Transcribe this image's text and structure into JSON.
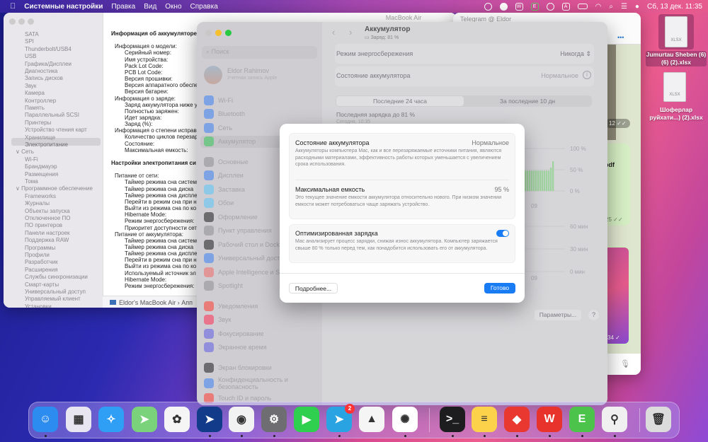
{
  "menubar": {
    "app": "Системные настройки",
    "items": [
      "Правка",
      "Вид",
      "Окно",
      "Справка"
    ],
    "clock": "Сб, 13 дек. 11:35"
  },
  "sysinfo": {
    "title": "MacBook Air",
    "sidebar": [
      "SATA",
      "SPI",
      "Thunderbolt/USB4",
      "USB",
      "Графика/Дисплеи",
      "Диагностика",
      "Запись дисков",
      "Звук",
      "Камера",
      "Контроллер",
      "Память",
      "Параллельный SCSI",
      "Принтеры",
      "Устройство чтения карт",
      "Хранилище",
      "Электропитание",
      "∨ Сеть",
      "Wi-Fi",
      "Брандмауэр",
      "Размещения",
      "Тома",
      "∨ Программное обеспечение",
      "Frameworks",
      "Журналы",
      "Объекты запуска",
      "Отключенное ПО",
      "ПО принтеров",
      "Панели настроек",
      "Поддержка RAW",
      "Программы",
      "Профили",
      "Разработчик",
      "Расширения",
      "Службы синхронизации",
      "Смарт-карты",
      "Универсальный доступ",
      "Управляемый клиент",
      "Установки"
    ],
    "selected": "Электропитание",
    "lines": [
      {
        "t": "Информация об аккумуляторе",
        "l": 0,
        "b": true
      },
      {
        "t": "",
        "l": 0
      },
      {
        "t": "Информация о модели:",
        "l": 1
      },
      {
        "t": "Серийный номер:",
        "l": 2
      },
      {
        "t": "Имя устройства:",
        "l": 2
      },
      {
        "t": "Pack Lot Code:",
        "l": 2
      },
      {
        "t": "PCB Lot Code:",
        "l": 2
      },
      {
        "t": "Версия прошивки:",
        "l": 2
      },
      {
        "t": "Версия аппаратного обеспе",
        "l": 2
      },
      {
        "t": "Версия батареи:",
        "l": 2
      },
      {
        "t": "Информация о заряде:",
        "l": 1
      },
      {
        "t": "Заряд аккумулятора ниже у",
        "l": 2
      },
      {
        "t": "Полностью заряжен:",
        "l": 2
      },
      {
        "t": "Идет зарядка:",
        "l": 2
      },
      {
        "t": "Заряд (%):",
        "l": 2
      },
      {
        "t": "Информация о степени исправ",
        "l": 1
      },
      {
        "t": "Количество циклов перезар",
        "l": 2
      },
      {
        "t": "Состояние:",
        "l": 2
      },
      {
        "t": "Максимальная емкость:",
        "l": 2
      },
      {
        "t": "",
        "l": 0
      },
      {
        "t": "Настройки электропитания си",
        "l": 0,
        "b": true
      },
      {
        "t": "",
        "l": 0
      },
      {
        "t": "Питание от сети:",
        "l": 1
      },
      {
        "t": "Таймер режима сна систем",
        "l": 2
      },
      {
        "t": "Таймер режима сна диска",
        "l": 2
      },
      {
        "t": "Таймер режима сна диспле",
        "l": 2
      },
      {
        "t": "Перейти в режим сна при н",
        "l": 2
      },
      {
        "t": "Выйти из режима сна по ко",
        "l": 2
      },
      {
        "t": "Hibernate Mode:",
        "l": 2
      },
      {
        "t": "Режим энергосбережения:",
        "l": 2
      },
      {
        "t": "Приоритет доступности сет",
        "l": 2
      },
      {
        "t": "Питание от аккумулятора:",
        "l": 1
      },
      {
        "t": "Таймер режима сна систем",
        "l": 2
      },
      {
        "t": "Таймер режима сна диска",
        "l": 2
      },
      {
        "t": "Таймер режима сна диспле",
        "l": 2
      },
      {
        "t": "Перейти в режим сна при н",
        "l": 2
      },
      {
        "t": "Выйти из режима сна по ко",
        "l": 2
      },
      {
        "t": "Используемый источник эл",
        "l": 2
      },
      {
        "t": "Hibernate Mode:",
        "l": 2
      },
      {
        "t": "Режим энергосбережения:",
        "l": 2
      }
    ],
    "path": "Eldor's MacBook Air › Апп"
  },
  "telegram": {
    "title": "Telegram @ Eldor",
    "more": "•••",
    "msgs": [
      "12 ✓✓",
      ".pdf",
      "25 ✓✓",
      "34 ✓"
    ]
  },
  "settings": {
    "search_placeholder": "Поиск",
    "user": {
      "name": "Eldor Rahimov",
      "sub": "Учетная запись Apple"
    },
    "groups": [
      [
        {
          "label": "Wi-Fi",
          "color": "#3b82f6"
        },
        {
          "label": "Bluetooth",
          "color": "#3b82f6"
        },
        {
          "label": "Сеть",
          "color": "#3b82f6"
        },
        {
          "label": "Аккумулятор",
          "color": "#34c759"
        }
      ],
      [
        {
          "label": "Основные",
          "color": "#8e8e93"
        },
        {
          "label": "Дисплеи",
          "color": "#3b82f6"
        },
        {
          "label": "Заставка",
          "color": "#5ac8fa"
        },
        {
          "label": "Обои",
          "color": "#5ac8fa"
        },
        {
          "label": "Оформление",
          "color": "#1c1c1e"
        },
        {
          "label": "Пункт управления",
          "color": "#8e8e93"
        },
        {
          "label": "Рабочий стол и Dock",
          "color": "#1c1c1e"
        },
        {
          "label": "Универсальный доступ",
          "color": "#3b82f6"
        },
        {
          "label": "Apple Intelligence и Siri",
          "color": "#f06a6a"
        },
        {
          "label": "Spotlight",
          "color": "#8e8e93"
        }
      ],
      [
        {
          "label": "Уведомления",
          "color": "#ff3b30"
        },
        {
          "label": "Звук",
          "color": "#ff2d55"
        },
        {
          "label": "Фокусирование",
          "color": "#5e5ce6"
        },
        {
          "label": "Экранное время",
          "color": "#5e5ce6"
        }
      ],
      [
        {
          "label": "Экран блокировки",
          "color": "#1c1c1e"
        },
        {
          "label": "Конфиденциальность и безопасность",
          "color": "#3b82f6"
        },
        {
          "label": "Touch ID и пароль",
          "color": "#ff3b30"
        }
      ]
    ],
    "selected": "Аккумулятор",
    "header": {
      "title": "Аккумулятор",
      "sub": "Заряд: 81 %"
    },
    "rows": [
      {
        "label": "Режим энергосбережения",
        "value": "Никогда"
      },
      {
        "label": "Состояние аккумулятора",
        "value": "Нормальное"
      }
    ],
    "segments": [
      "Последние 24 часа",
      "За последние 10 дн"
    ],
    "active_segment": 0,
    "last_charge": "Последняя зарядка до 81 %",
    "last_charge_time": "Сегодня, 10:35",
    "chart": {
      "level_ticks": [
        "100 %",
        "50 %",
        "0 %"
      ],
      "usage_ticks": [
        "60 мин",
        "30 мин",
        "0 мин"
      ],
      "x_label": "09",
      "battery_levels_pct": [
        48,
        48,
        48,
        48,
        48,
        48,
        48,
        48,
        48,
        48,
        48,
        48,
        48,
        48,
        55,
        70
      ]
    },
    "params_button": "Параметры...",
    "help": "?"
  },
  "modal": {
    "health": {
      "title": "Состояние аккумулятора",
      "value": "Нормальное",
      "desc": "Аккумуляторы компьютера Mac, как и все перезаряжаемые источники питания, являются расходными материалами, эффективность работы которых уменьшается с увеличением срока использования."
    },
    "capacity": {
      "title": "Максимальная емкость",
      "value": "95 %",
      "desc": "Это текущее значение емкости аккумулятора относительно нового. При низком значении емкости может потребоваться чаще заряжать устройство."
    },
    "optimized": {
      "title": "Оптимизированная зарядка",
      "enabled": true,
      "desc": "Mac анализирует процесс зарядки, снижая износ аккумулятора. Компьютер заряжается свыше 80 % только перед тем, как понадобится использовать его от аккумулятора."
    },
    "more_button": "Подробнее...",
    "done_button": "Готово",
    "accent": "#1a7cf5"
  },
  "desktop": [
    {
      "name": "Jumurtau Sheben (6) (6) (2).xlsx",
      "ext": "XLSX"
    },
    {
      "name": "Шоферлар руйхати...) (2).xlsx",
      "ext": "XLSX"
    }
  ],
  "dock": {
    "apps": [
      {
        "name": "finder",
        "color": "#2d8cf0",
        "glyph": "☺",
        "running": true
      },
      {
        "name": "launchpad",
        "color": "#e8e6f0",
        "glyph": "▦",
        "running": false
      },
      {
        "name": "safari",
        "color": "#2f9ef5",
        "glyph": "✧",
        "running": false
      },
      {
        "name": "maps",
        "color": "#7ad27a",
        "glyph": "➤",
        "running": false
      },
      {
        "name": "photos",
        "color": "#f5f5f5",
        "glyph": "✿",
        "running": false
      },
      {
        "name": "spark",
        "color": "#123c8a",
        "glyph": "➤",
        "running": true
      },
      {
        "name": "chrome",
        "color": "#f2f2f2",
        "glyph": "◉",
        "running": true
      },
      {
        "name": "system-settings",
        "color": "#6d6d72",
        "glyph": "⚙",
        "running": true
      },
      {
        "name": "facetime",
        "color": "#2fcf4f",
        "glyph": "▶",
        "running": false
      },
      {
        "name": "telegram",
        "color": "#2aa3e3",
        "glyph": "➤",
        "running": true,
        "badge": "2"
      },
      {
        "name": "inkscape",
        "color": "#f5f5f5",
        "glyph": "▲",
        "running": false
      },
      {
        "name": "chatgpt",
        "color": "#ffffff",
        "glyph": "✺",
        "running": true
      },
      {
        "name": "terminal",
        "color": "#1d1d1f",
        "glyph": ">_",
        "running": true
      },
      {
        "name": "notes",
        "color": "#fbd24a",
        "glyph": "≡",
        "running": true
      },
      {
        "name": "anydesk",
        "color": "#e8382f",
        "glyph": "◆",
        "running": true
      },
      {
        "name": "wps-office",
        "color": "#e8322c",
        "glyph": "W",
        "running": true
      },
      {
        "name": "e-app",
        "color": "#4cc44c",
        "glyph": "E",
        "running": true
      },
      {
        "name": "app-tool",
        "color": "#f0f0f0",
        "glyph": "⚲",
        "running": true
      },
      {
        "name": "trash",
        "color": "#dcdcdc",
        "glyph": "🗑",
        "running": false
      }
    ]
  }
}
